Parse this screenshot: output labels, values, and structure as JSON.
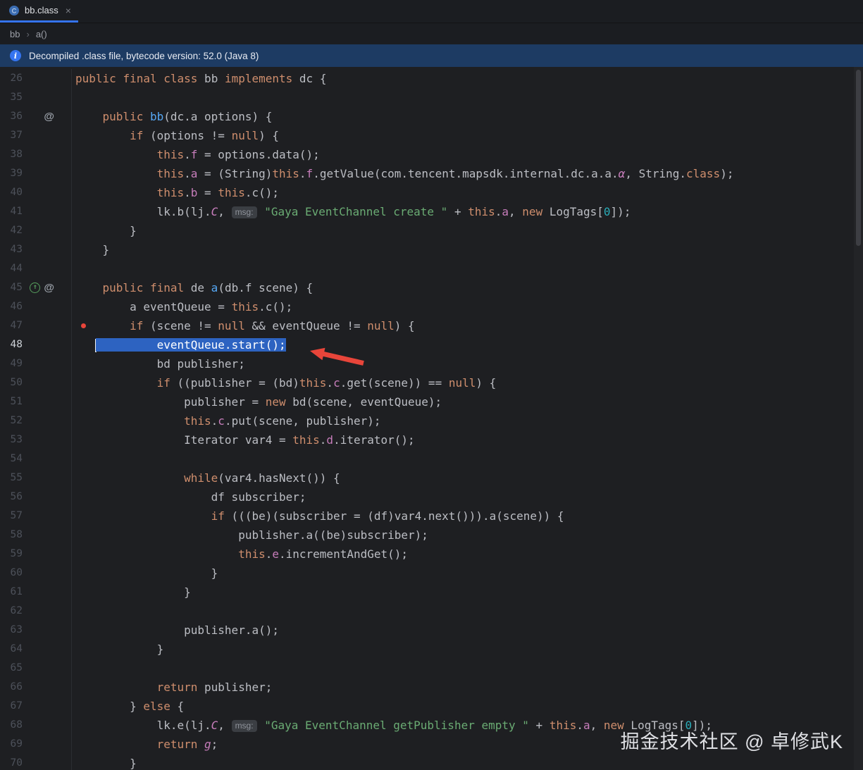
{
  "tab_bar": {
    "tab": {
      "label": "bb.class",
      "close": "×"
    }
  },
  "breadcrumbs": {
    "root": "bb",
    "separator": "›",
    "method": "a()"
  },
  "banner": {
    "text": "Decompiled .class file, bytecode version: 52.0 (Java 8)"
  },
  "watermark": {
    "text": "掘金技术社区 @ 卓修武K"
  },
  "palette": {
    "accent": "#3574f0",
    "selection": "#2d63c1",
    "keyword": "#cf8e6d",
    "string": "#6aab73",
    "number": "#2aacb8",
    "field": "#c77dbb",
    "method_declaration": "#56a8f5",
    "default_text": "#bcbec4",
    "banner_bg": "#1d3b63",
    "editor_bg": "#1e1f22",
    "arrow": "#e8453a"
  },
  "editor": {
    "selected_line": 48,
    "lines": [
      {
        "n": 26,
        "t": [
          [
            "k",
            "public"
          ],
          [
            "d",
            " "
          ],
          [
            "k",
            "final"
          ],
          [
            "d",
            " "
          ],
          [
            "k",
            "class"
          ],
          [
            "d",
            " bb "
          ],
          [
            "k",
            "implements"
          ],
          [
            "d",
            " dc {"
          ]
        ]
      },
      {
        "n": 35,
        "t": []
      },
      {
        "n": 36,
        "icons": [
          "at"
        ],
        "t": [
          [
            "d",
            "    "
          ],
          [
            "k",
            "public"
          ],
          [
            "d",
            " "
          ],
          [
            "m",
            "bb"
          ],
          [
            "d",
            "(dc.a options) {"
          ]
        ]
      },
      {
        "n": 37,
        "t": [
          [
            "d",
            "        "
          ],
          [
            "k",
            "if"
          ],
          [
            "d",
            " (options != "
          ],
          [
            "k",
            "null"
          ],
          [
            "d",
            ") {"
          ]
        ]
      },
      {
        "n": 38,
        "t": [
          [
            "d",
            "            "
          ],
          [
            "k",
            "this"
          ],
          [
            "d",
            "."
          ],
          [
            "f",
            "f"
          ],
          [
            "d",
            " = options.data();"
          ]
        ]
      },
      {
        "n": 39,
        "t": [
          [
            "d",
            "            "
          ],
          [
            "k",
            "this"
          ],
          [
            "d",
            "."
          ],
          [
            "f",
            "a"
          ],
          [
            "d",
            " = (String)"
          ],
          [
            "k",
            "this"
          ],
          [
            "d",
            "."
          ],
          [
            "f",
            "f"
          ],
          [
            "d",
            ".getValue(com.tencent.mapsdk.internal.dc.a.a."
          ],
          [
            "i",
            "α"
          ],
          [
            "d",
            ", String."
          ],
          [
            "k",
            "class"
          ],
          [
            "d",
            ");"
          ]
        ]
      },
      {
        "n": 40,
        "t": [
          [
            "d",
            "            "
          ],
          [
            "k",
            "this"
          ],
          [
            "d",
            "."
          ],
          [
            "f",
            "b"
          ],
          [
            "d",
            " = "
          ],
          [
            "k",
            "this"
          ],
          [
            "d",
            ".c();"
          ]
        ]
      },
      {
        "n": 41,
        "t": [
          [
            "d",
            "            lk.b(lj."
          ],
          [
            "i",
            "C"
          ],
          [
            "d",
            ", "
          ],
          [
            "h",
            "msg:"
          ],
          [
            "d",
            " "
          ],
          [
            "s",
            "\"Gaya EventChannel create \""
          ],
          [
            "d",
            " + "
          ],
          [
            "k",
            "this"
          ],
          [
            "d",
            "."
          ],
          [
            "f",
            "a"
          ],
          [
            "d",
            ", "
          ],
          [
            "k",
            "new"
          ],
          [
            "d",
            " LogTags["
          ],
          [
            "n",
            "0"
          ],
          [
            "d",
            "]);"
          ]
        ]
      },
      {
        "n": 42,
        "t": [
          [
            "d",
            "        }"
          ]
        ]
      },
      {
        "n": 43,
        "t": [
          [
            "d",
            "    }"
          ]
        ]
      },
      {
        "n": 44,
        "t": []
      },
      {
        "n": 45,
        "icons": [
          "ovr",
          "at"
        ],
        "t": [
          [
            "d",
            "    "
          ],
          [
            "k",
            "public"
          ],
          [
            "d",
            " "
          ],
          [
            "k",
            "final"
          ],
          [
            "d",
            " de "
          ],
          [
            "m",
            "a"
          ],
          [
            "d",
            "(db.f scene) {"
          ]
        ]
      },
      {
        "n": 46,
        "t": [
          [
            "d",
            "        a eventQueue = "
          ],
          [
            "k",
            "this"
          ],
          [
            "d",
            ".c();"
          ]
        ]
      },
      {
        "n": 47,
        "breakpoint": true,
        "t": [
          [
            "d",
            "        "
          ],
          [
            "k",
            "if"
          ],
          [
            "d",
            " (scene != "
          ],
          [
            "k",
            "null"
          ],
          [
            "d",
            " && eventQueue != "
          ],
          [
            "k",
            "null"
          ],
          [
            "d",
            ") {"
          ]
        ]
      },
      {
        "n": 48,
        "active": true,
        "t": [
          [
            "d",
            "   "
          ],
          [
            "c",
            ""
          ],
          [
            "x",
            "         eventQueue.start();"
          ]
        ]
      },
      {
        "n": 49,
        "t": [
          [
            "d",
            "            bd publisher;"
          ]
        ]
      },
      {
        "n": 50,
        "t": [
          [
            "d",
            "            "
          ],
          [
            "k",
            "if"
          ],
          [
            "d",
            " ((publisher = (bd)"
          ],
          [
            "k",
            "this"
          ],
          [
            "d",
            "."
          ],
          [
            "f",
            "c"
          ],
          [
            "d",
            ".get(scene)) == "
          ],
          [
            "k",
            "null"
          ],
          [
            "d",
            ") {"
          ]
        ]
      },
      {
        "n": 51,
        "t": [
          [
            "d",
            "                publisher = "
          ],
          [
            "k",
            "new"
          ],
          [
            "d",
            " bd(scene, eventQueue);"
          ]
        ]
      },
      {
        "n": 52,
        "t": [
          [
            "d",
            "                "
          ],
          [
            "k",
            "this"
          ],
          [
            "d",
            "."
          ],
          [
            "f",
            "c"
          ],
          [
            "d",
            ".put(scene, publisher);"
          ]
        ]
      },
      {
        "n": 53,
        "t": [
          [
            "d",
            "                Iterator var4 = "
          ],
          [
            "k",
            "this"
          ],
          [
            "d",
            "."
          ],
          [
            "f",
            "d"
          ],
          [
            "d",
            ".iterator();"
          ]
        ]
      },
      {
        "n": 54,
        "t": []
      },
      {
        "n": 55,
        "t": [
          [
            "d",
            "                "
          ],
          [
            "k",
            "while"
          ],
          [
            "d",
            "(var4.hasNext()) {"
          ]
        ]
      },
      {
        "n": 56,
        "t": [
          [
            "d",
            "                    df subscriber;"
          ]
        ]
      },
      {
        "n": 57,
        "t": [
          [
            "d",
            "                    "
          ],
          [
            "k",
            "if"
          ],
          [
            "d",
            " (((be)(subscriber = (df)var4.next())).a(scene)) {"
          ]
        ]
      },
      {
        "n": 58,
        "t": [
          [
            "d",
            "                        publisher.a((be)subscriber);"
          ]
        ]
      },
      {
        "n": 59,
        "t": [
          [
            "d",
            "                        "
          ],
          [
            "k",
            "this"
          ],
          [
            "d",
            "."
          ],
          [
            "f",
            "e"
          ],
          [
            "d",
            ".incrementAndGet();"
          ]
        ]
      },
      {
        "n": 60,
        "t": [
          [
            "d",
            "                    }"
          ]
        ]
      },
      {
        "n": 61,
        "t": [
          [
            "d",
            "                }"
          ]
        ]
      },
      {
        "n": 62,
        "t": []
      },
      {
        "n": 63,
        "t": [
          [
            "d",
            "                publisher.a();"
          ]
        ]
      },
      {
        "n": 64,
        "t": [
          [
            "d",
            "            }"
          ]
        ]
      },
      {
        "n": 65,
        "t": []
      },
      {
        "n": 66,
        "t": [
          [
            "d",
            "            "
          ],
          [
            "k",
            "return"
          ],
          [
            "d",
            " publisher;"
          ]
        ]
      },
      {
        "n": 67,
        "t": [
          [
            "d",
            "        } "
          ],
          [
            "k",
            "else"
          ],
          [
            "d",
            " {"
          ]
        ]
      },
      {
        "n": 68,
        "t": [
          [
            "d",
            "            lk.e(lj."
          ],
          [
            "i",
            "C"
          ],
          [
            "d",
            ", "
          ],
          [
            "h",
            "msg:"
          ],
          [
            "d",
            " "
          ],
          [
            "s",
            "\"Gaya EventChannel getPublisher empty \""
          ],
          [
            "d",
            " + "
          ],
          [
            "k",
            "this"
          ],
          [
            "d",
            "."
          ],
          [
            "f",
            "a"
          ],
          [
            "d",
            ", "
          ],
          [
            "k",
            "new"
          ],
          [
            "d",
            " LogTags["
          ],
          [
            "n",
            "0"
          ],
          [
            "d",
            "]);"
          ]
        ]
      },
      {
        "n": 69,
        "t": [
          [
            "d",
            "            "
          ],
          [
            "k",
            "return"
          ],
          [
            "d",
            " "
          ],
          [
            "i",
            "g"
          ],
          [
            "d",
            ";"
          ]
        ]
      },
      {
        "n": 70,
        "t": [
          [
            "d",
            "        }"
          ]
        ]
      }
    ]
  }
}
